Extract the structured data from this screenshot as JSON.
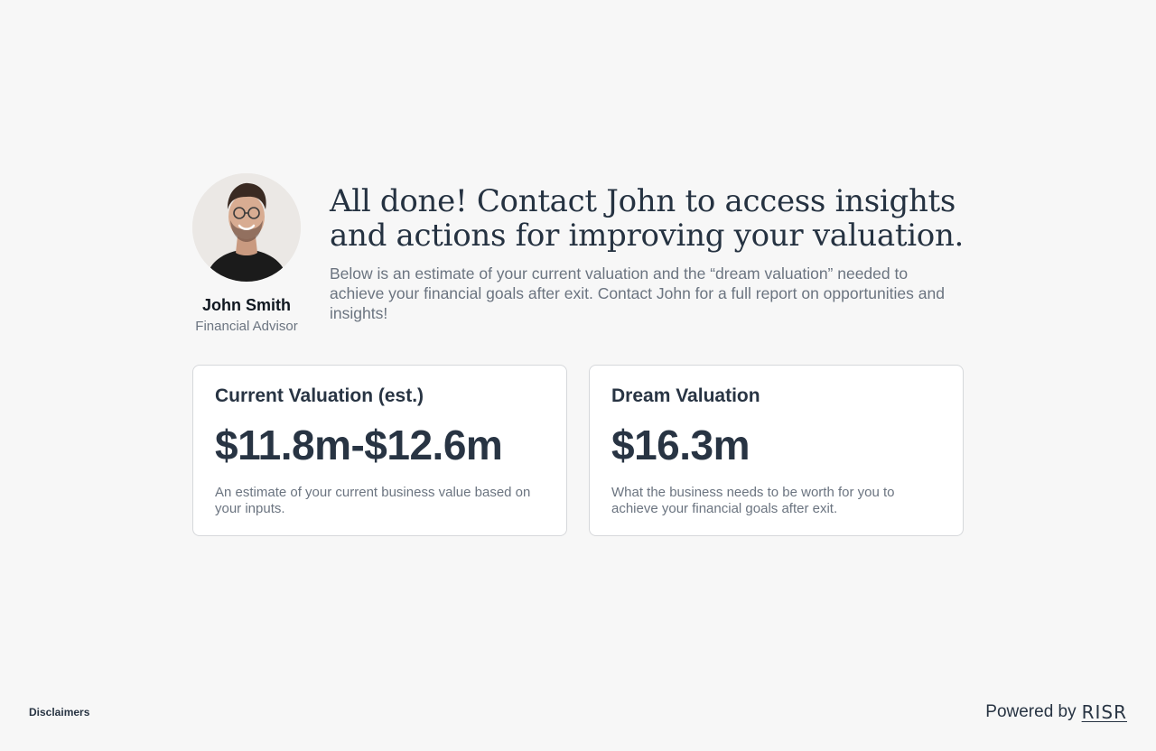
{
  "advisor": {
    "name": "John Smith",
    "role": "Financial Advisor"
  },
  "intro": {
    "headline": "All done! Contact John to access insights and actions for improving your valuation.",
    "subtext": "Below is an estimate of your current valuation and the “dream valuation” needed to achieve your financial goals after exit. Contact John for a full report on opportunities and insights!"
  },
  "cards": {
    "current": {
      "title": "Current Valuation (est.)",
      "value": "$11.8m-$12.6m",
      "description": "An estimate of your current business value based on your inputs."
    },
    "dream": {
      "title": "Dream Valuation",
      "value": "$16.3m",
      "description": "What the business needs to be worth for you to achieve your financial goals after exit."
    }
  },
  "footer": {
    "disclaimers": "Disclaimers",
    "powered_by": "Powered by",
    "brand": "RISR"
  },
  "colors": {
    "background": "#f7f7f7",
    "text_primary": "#283443",
    "text_muted": "#6b7480",
    "card_border": "#d6d8db"
  }
}
